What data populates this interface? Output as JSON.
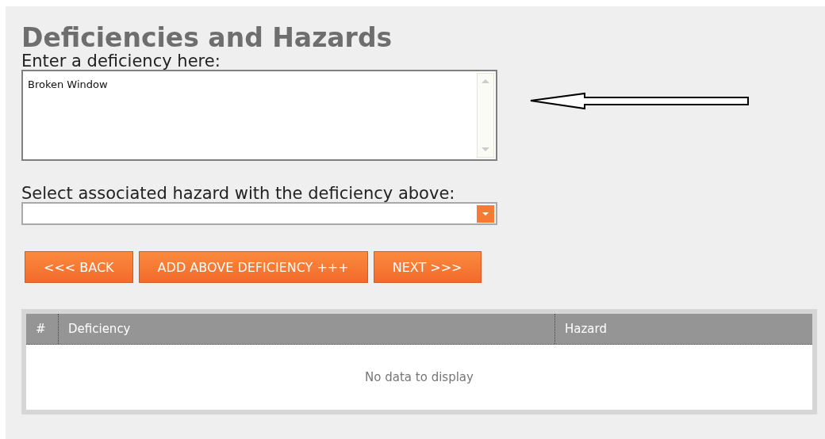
{
  "title": "Deficiencies and Hazards",
  "deficiency": {
    "label": "Enter a deficiency here:",
    "value": "Broken Window"
  },
  "hazard": {
    "label": "Select associated hazard with the deficiency above:"
  },
  "buttons": [
    {
      "label": "<<< BACK"
    },
    {
      "label": "ADD ABOVE DEFICIENCY +++"
    },
    {
      "label": "NEXT >>>"
    }
  ],
  "table": {
    "columns": [
      "#",
      "Deficiency",
      "Hazard"
    ],
    "empty_text": "No data to display"
  }
}
